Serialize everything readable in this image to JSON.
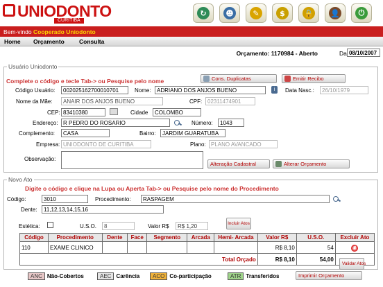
{
  "header": {
    "logo": "UNIODONTO",
    "logo_sub": "CURITIBA"
  },
  "top_icons": [
    {
      "name": "refresh-icon",
      "color": "#2e8b57",
      "glyph": "↻"
    },
    {
      "name": "people-icon",
      "color": "#3a6ea5",
      "glyph": "☻"
    },
    {
      "name": "edit-document-icon",
      "color": "#d9a400",
      "glyph": "✎"
    },
    {
      "name": "dollar-icon",
      "color": "#c9a000",
      "glyph": "$"
    },
    {
      "name": "lock-icon",
      "color": "#d0a000",
      "glyph": "🔒"
    },
    {
      "name": "user-icon",
      "color": "#7a4a2a",
      "glyph": "👤"
    },
    {
      "name": "exit-icon",
      "color": "#3b9b3b",
      "glyph": "⏻"
    }
  ],
  "welcome": {
    "prefix": "Bem-vindo",
    "user": "Cooperado Uniodonto"
  },
  "menu": {
    "home": "Home",
    "orcamento": "Orçamento",
    "consulta": "Consulta"
  },
  "orcamento": {
    "title": "Orçamento: 1170984 - Aberto",
    "data_label": "Data",
    "data_value": "08/10/2007"
  },
  "usuario": {
    "legend": "Usuário Uniodonto",
    "instruction": "Complete o código e tecle Tab-> ou Pesquise pelo nome",
    "btn_duplicatas": "Cons. Duplicatas",
    "btn_recibo": "Emitir Recibo",
    "codigo_label": "Código Usuário:",
    "codigo": "00202516270001070​1",
    "nome_label": "Nome:",
    "nome": "ADRIANO DOS ANJOS BUENO",
    "nasc_label": "Data Nasc.:",
    "nasc": "26/10/1979",
    "mae_label": "Nome da Mãe:",
    "mae": "ANAIR DOS ANJOS BUENO",
    "cpf_label": "CPF:",
    "cpf": "02311474901",
    "cep_label": "CEP:",
    "cep": "83410380",
    "cidade_label": "Cidade",
    "cidade": "COLOMBO",
    "endereco_label": "Endereço:",
    "endereco": "R PEDRO DO ROSARIO",
    "numero_label": "Número:",
    "numero": "1043",
    "complemento_label": "Complemento:",
    "complemento": "CASA",
    "bairro_label": "Bairro:",
    "bairro": "JARDIM GUARATUBA",
    "empresa_label": "Empresa:",
    "empresa": "UNIODONTO DE CURITIBA",
    "plano_label": "Plano:",
    "plano": "PLANO AVANCADO",
    "obs_label": "Observação:",
    "btn_alteracao": "Alteração Cadastral",
    "btn_alterar_orc": "Alterar Orçamento"
  },
  "novo_ato": {
    "legend": "Novo Ato",
    "instruction": "Digite o código e clique na Lupa ou Aperta Tab-> ou Pesquise pelo nome do Procedimento",
    "codigo_label": "Código:",
    "codigo": "3010",
    "proc_label": "Procedimento:",
    "proc": "RASPAGEM",
    "dente_label": "Dente:",
    "dente": "11,12,13,14,15,16",
    "estetica_label": "Estética:",
    "uso_label": "U.S.O.",
    "uso": "8",
    "valor_label": "Valor R$",
    "valor": "R$ 1,20",
    "btn_incluir": "Incluir Atos",
    "btn_validar": "Validar Atos"
  },
  "table": {
    "headers": [
      "Código",
      "Procedimento",
      "Dente",
      "Face",
      "Segmento",
      "Arcada",
      "Hemi- Arcada",
      "Valor R$",
      "U.S.O.",
      "Excluir Ato"
    ],
    "rows": [
      {
        "codigo": "110",
        "procedimento": "EXAME CLINICO",
        "dente": "",
        "face": "",
        "segmento": "",
        "arcada": "",
        "hemi": "",
        "valor": "R$ 8,10",
        "uso": "54"
      }
    ],
    "total_label": "Total Orçado",
    "total_valor": "R$ 8,10",
    "total_uso": "54,00"
  },
  "legend": [
    {
      "code": "ANC",
      "label": "Não-Cobertos",
      "color": "#e8c8c8"
    },
    {
      "code": "AEC",
      "label": "Carência",
      "color": "#e4e4e4"
    },
    {
      "code": "ACO",
      "label": "Co-participação",
      "color": "#f0b23a"
    },
    {
      "code": "ATR",
      "label": "Transferidos",
      "color": "#9fd48a"
    }
  ],
  "btn_imprimir": "Imprimir Orçamento"
}
